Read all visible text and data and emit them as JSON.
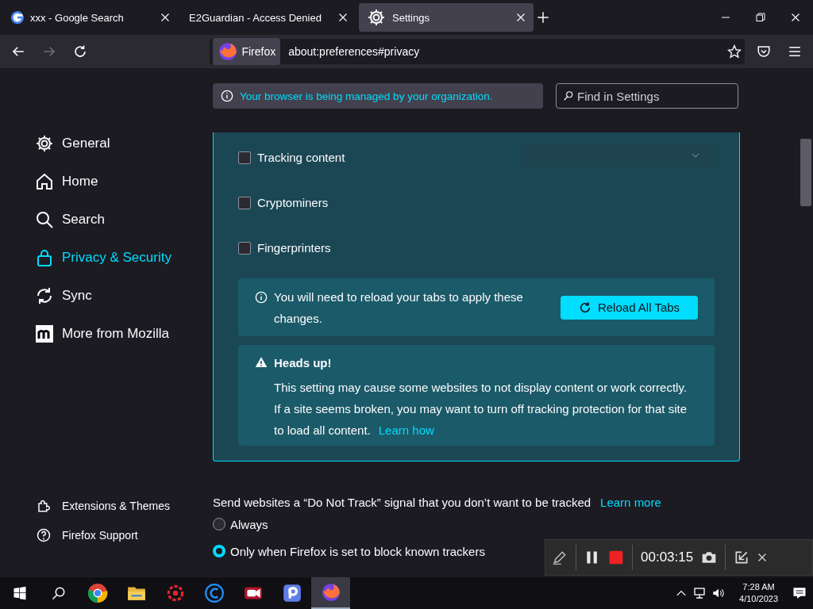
{
  "tabs": [
    {
      "title": "xxx - Google Search",
      "selected": false
    },
    {
      "title": "E2Guardian - Access Denied",
      "selected": false
    },
    {
      "title": "Settings",
      "selected": true
    }
  ],
  "nav": {
    "identity": "Firefox",
    "url": "about:preferences#privacy"
  },
  "notice": {
    "text": "Your browser is being managed by your organization.",
    "search_placeholder": "Find in Settings"
  },
  "sidebar": {
    "items": [
      {
        "label": "General",
        "selected": false
      },
      {
        "label": "Home",
        "selected": false
      },
      {
        "label": "Search",
        "selected": false
      },
      {
        "label": "Privacy & Security",
        "selected": true
      },
      {
        "label": "Sync",
        "selected": false
      },
      {
        "label": "More from Mozilla",
        "selected": false
      }
    ],
    "footer": [
      {
        "label": "Extensions & Themes"
      },
      {
        "label": "Firefox Support"
      }
    ]
  },
  "section": {
    "checkboxes": [
      {
        "label": "Tracking content",
        "checked": false
      },
      {
        "label": "Cryptominers",
        "checked": false
      },
      {
        "label": "Fingerprinters",
        "checked": false
      }
    ],
    "reload": {
      "text": "You will need to reload your tabs to apply these changes.",
      "button": "Reload All Tabs"
    },
    "warning": {
      "title": "Heads up!",
      "text": "This setting may cause some websites to not display content or work correctly. If a site seems broken, you may want to turn off tracking protection for that site to load all content.",
      "link": "Learn how"
    }
  },
  "dnt": {
    "text": "Send websites a “Do Not Track” signal that you don’t want to be tracked",
    "link": "Learn more",
    "options": [
      {
        "label": "Always",
        "selected": false
      },
      {
        "label": "Only when Firefox is set to block known trackers",
        "selected": true
      }
    ]
  },
  "recorder": {
    "time": "00:03:15"
  },
  "taskbar": {
    "apps": [
      {
        "kind": "browser",
        "active": false
      },
      {
        "kind": "folder",
        "active": false
      },
      {
        "kind": "gear",
        "active": false
      },
      {
        "kind": "ring",
        "active": false
      },
      {
        "kind": "camera",
        "active": false
      },
      {
        "kind": "tile",
        "active": false
      },
      {
        "kind": "firefox",
        "active": true
      }
    ],
    "time": "7:28 AM",
    "date": "4/10/2023"
  }
}
